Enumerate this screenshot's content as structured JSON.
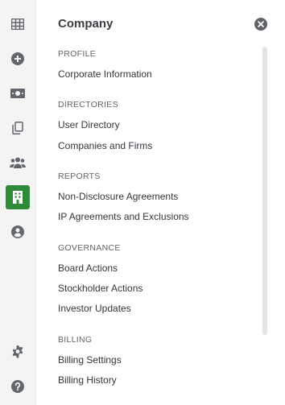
{
  "rail": {
    "items": [
      {
        "icon": "grid-icon"
      },
      {
        "icon": "plus-circle-icon"
      },
      {
        "icon": "money-icon"
      },
      {
        "icon": "copy-icon"
      },
      {
        "icon": "people-icon"
      },
      {
        "icon": "building-icon",
        "active": true
      },
      {
        "icon": "user-circle-icon"
      }
    ],
    "bottom": [
      {
        "icon": "gear-icon"
      },
      {
        "icon": "help-icon"
      }
    ],
    "active_color": "#2f8a3a"
  },
  "panel": {
    "title": "Company",
    "sections": [
      {
        "heading": "PROFILE",
        "links": [
          "Corporate Information"
        ]
      },
      {
        "heading": "DIRECTORIES",
        "links": [
          "User Directory",
          "Companies and Firms"
        ]
      },
      {
        "heading": "REPORTS",
        "links": [
          "Non-Disclosure Agreements",
          "IP Agreements and Exclusions"
        ]
      },
      {
        "heading": "GOVERNANCE",
        "links": [
          "Board Actions",
          "Stockholder Actions",
          "Investor Updates"
        ]
      },
      {
        "heading": "BILLING",
        "links": [
          "Billing Settings",
          "Billing History"
        ]
      }
    ]
  }
}
